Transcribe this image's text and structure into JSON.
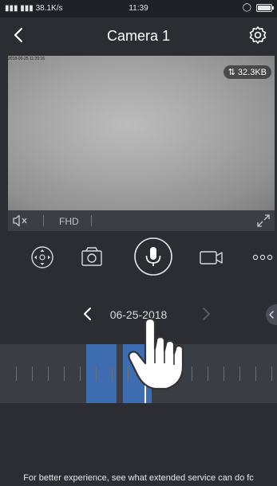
{
  "statusbar": {
    "signal": "▮▮▮ ▮▮▮ 38.1K/s",
    "time": "11:39"
  },
  "header": {
    "title": "Camera 1"
  },
  "video": {
    "timestamp": "2018-06-25 11:39:16",
    "bitrate": "32.3KB"
  },
  "videobar": {
    "quality": "FHD"
  },
  "date": {
    "value": "06-25-2018"
  },
  "footer": {
    "text": "For better experience, see what extended service can do fc"
  },
  "colors": {
    "background": "#2b2d33",
    "accent": "#3d6cb0"
  },
  "icons": [
    "back-icon",
    "gear-icon",
    "mute-icon",
    "fullscreen-icon",
    "ptz-icon",
    "snapshot-icon",
    "microphone-icon",
    "record-icon",
    "more-icon",
    "chevron-left-icon",
    "chevron-right-icon",
    "hand-pointer-icon"
  ]
}
